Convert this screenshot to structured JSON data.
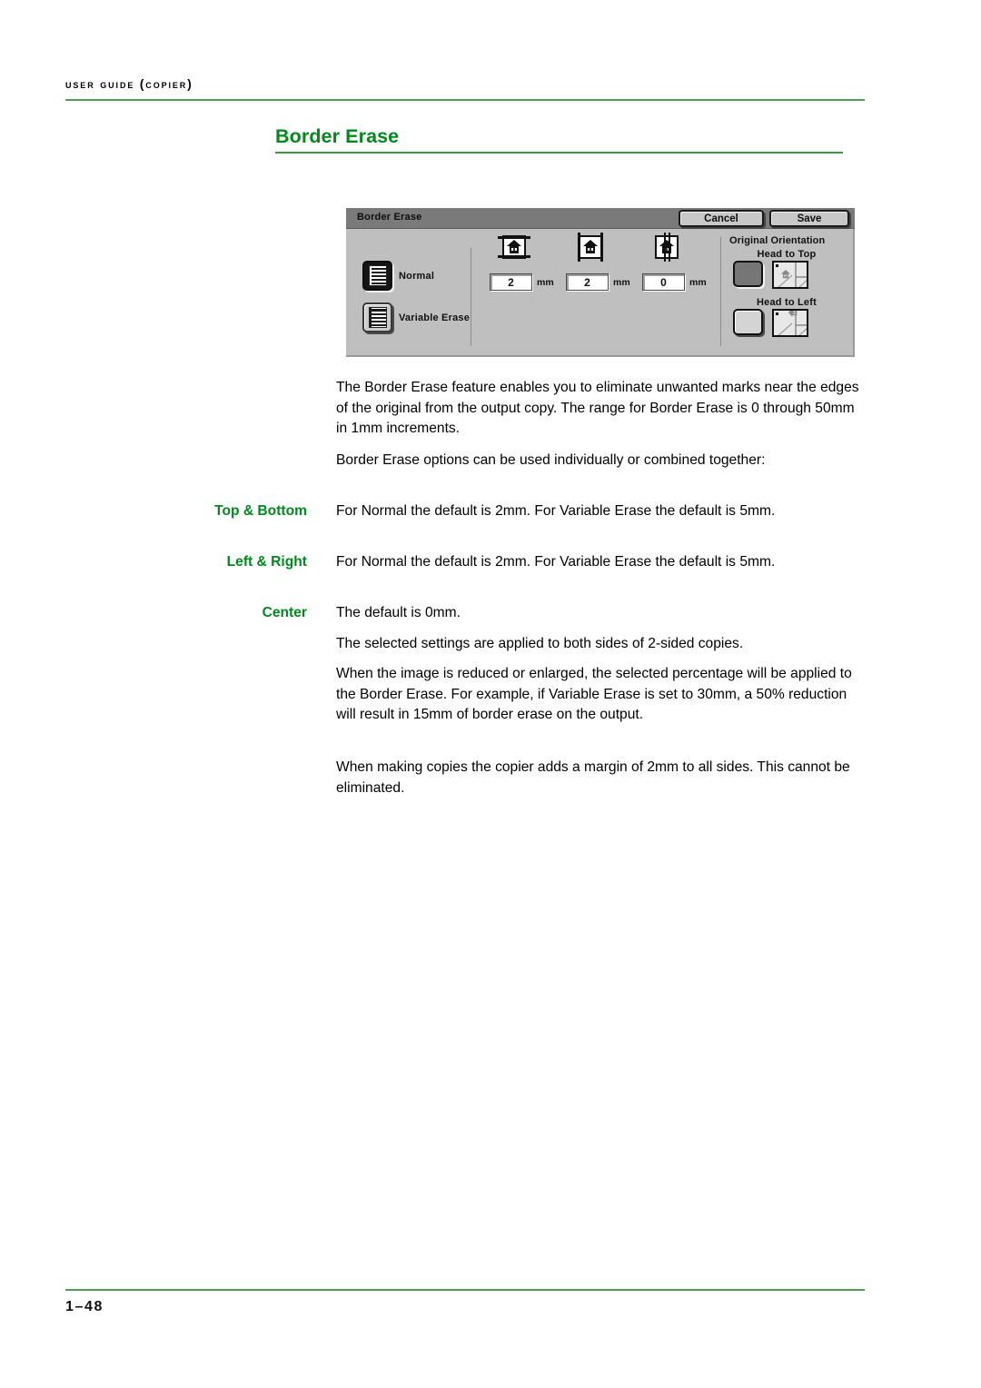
{
  "header": {
    "running_head": "User Guide (Copier)"
  },
  "heading": {
    "title": "Border Erase"
  },
  "ui_panel": {
    "title": "Border Erase",
    "cancel_label": "Cancel",
    "save_label": "Save",
    "modes": [
      {
        "label": "Normal",
        "selected": true,
        "icon": "document-lines-icon"
      },
      {
        "label": "Variable Erase",
        "selected": false,
        "icon": "document-lines-bars-icon"
      }
    ],
    "erase_settings": [
      {
        "name": "top-bottom",
        "value": "2",
        "unit": "mm",
        "icon": "edge-top-bottom-icon"
      },
      {
        "name": "left-right",
        "value": "2",
        "unit": "mm",
        "icon": "edge-left-right-icon"
      },
      {
        "name": "center",
        "value": "0",
        "unit": "mm",
        "icon": "edge-center-icon"
      }
    ],
    "orientation": {
      "title": "Original Orientation",
      "options": [
        {
          "label": "Head to Top",
          "selected": true,
          "thumb": "head-to-top-thumb-icon"
        },
        {
          "label": "Head to Left",
          "selected": false,
          "thumb": "head-to-left-thumb-icon"
        }
      ]
    }
  },
  "body": {
    "p1": "The Border Erase feature enables you to eliminate unwanted marks near the edges of the original from the output copy.  The range for Border Erase is 0 through 50mm in 1mm increments.",
    "p2": "Border Erase options can be used individually or combined together:",
    "p3": "The selected settings are applied to both sides of 2-sided copies.",
    "p4": "When the image is reduced or enlarged, the selected percentage will be applied to the Border Erase.  For example, if Variable Erase is set to 30mm, a 50% reduction will result in 15mm of border erase on the output.",
    "p5": "When making copies the copier adds a margin of 2mm to all sides. This cannot be eliminated."
  },
  "definitions": [
    {
      "term": "Top & Bottom",
      "desc": "For Normal the default is 2mm. For Variable Erase the default is 5mm."
    },
    {
      "term": "Left & Right",
      "desc": "For Normal the default is 2mm. For Variable Erase the default is 5mm."
    },
    {
      "term": "Center",
      "desc": "The default is 0mm."
    }
  ],
  "footer": {
    "page_number": "1–48"
  },
  "colors": {
    "heading_green": "#008a1e",
    "rule_green": "#4fa055",
    "panel_gray": "#bfbfbf",
    "titlebar_gray": "#7a7a7a"
  }
}
